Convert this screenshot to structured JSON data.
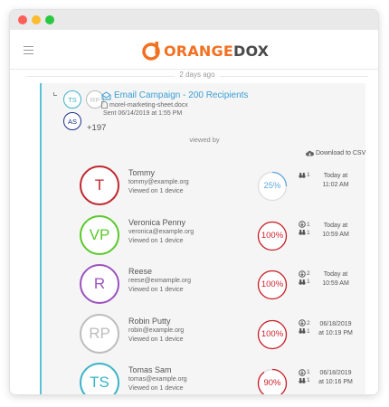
{
  "app": {
    "logo_text_orange": "ORANGE",
    "logo_text_dark": "DOX"
  },
  "colors": {
    "accent": "#f37021",
    "link": "#3a9ed4",
    "panel_border": "#58c2d9"
  },
  "activity": {
    "day_separator": "2 days ago",
    "campaign": {
      "title": "Email Campaign - 200 Recipients",
      "file": "morel-marketing-sheet.docx",
      "sent": "Sent 06/14/2019 at 1:55 PM",
      "recipient_avatars": [
        {
          "initials": "TS",
          "color": "#3ab3c8"
        },
        {
          "initials": "RP",
          "color": "#bbbbbb"
        },
        {
          "initials": "AS",
          "color": "#1a2f8c"
        }
      ],
      "extra_recipients": "+197"
    },
    "viewed_by_label": "viewed by",
    "download_label": "Download to CSV",
    "viewers": [
      {
        "initials": "T",
        "name": "Tommy",
        "email": "tommy@example.org",
        "devices": "Viewed on 1 device",
        "avatar_color": "#c0272d",
        "percent": 25,
        "percent_label": "25%",
        "ring_color": "#5fa8dd",
        "stats": [
          {
            "icon": "binoculars-icon",
            "value": "1"
          }
        ],
        "time_line1": "Today at",
        "time_line2": "11:02 AM"
      },
      {
        "initials": "VP",
        "name": "Veronica Penny",
        "email": "veronica@example.org",
        "devices": "Viewed on 1 device",
        "avatar_color": "#5ac92c",
        "percent": 100,
        "percent_label": "100%",
        "ring_color": "#cc1f28",
        "stats": [
          {
            "icon": "download-icon",
            "value": "1"
          },
          {
            "icon": "binoculars-icon",
            "value": "1"
          }
        ],
        "time_line1": "Today at",
        "time_line2": "10:59 AM"
      },
      {
        "initials": "R",
        "name": "Reese",
        "email": "reese@exmample.org",
        "devices": "Viewed on 1 device",
        "avatar_color": "#9b52bf",
        "percent": 100,
        "percent_label": "100%",
        "ring_color": "#cc1f28",
        "stats": [
          {
            "icon": "download-icon",
            "value": "2"
          },
          {
            "icon": "binoculars-icon",
            "value": "1"
          }
        ],
        "time_line1": "Today at",
        "time_line2": "10:59 AM"
      },
      {
        "initials": "RP",
        "name": "Robin Putty",
        "email": "robin@example.org",
        "devices": "Viewed on 1 device",
        "avatar_color": "#bdbdbd",
        "percent": 100,
        "percent_label": "100%",
        "ring_color": "#cc1f28",
        "stats": [
          {
            "icon": "download-icon",
            "value": "2"
          },
          {
            "icon": "binoculars-icon",
            "value": "1"
          }
        ],
        "time_line1": "06/18/2019",
        "time_line2": "at 10:19 PM"
      },
      {
        "initials": "TS",
        "name": "Tomas Sam",
        "email": "tomas@example.org",
        "devices": "Viewed on 1 device",
        "avatar_color": "#3ab3c8",
        "percent": 90,
        "percent_label": "90%",
        "ring_color": "#cc1f28",
        "stats": [
          {
            "icon": "download-icon",
            "value": "1"
          },
          {
            "icon": "binoculars-icon",
            "value": "1"
          }
        ],
        "time_line1": "06/18/2019",
        "time_line2": "at 10:16 PM"
      }
    ]
  }
}
